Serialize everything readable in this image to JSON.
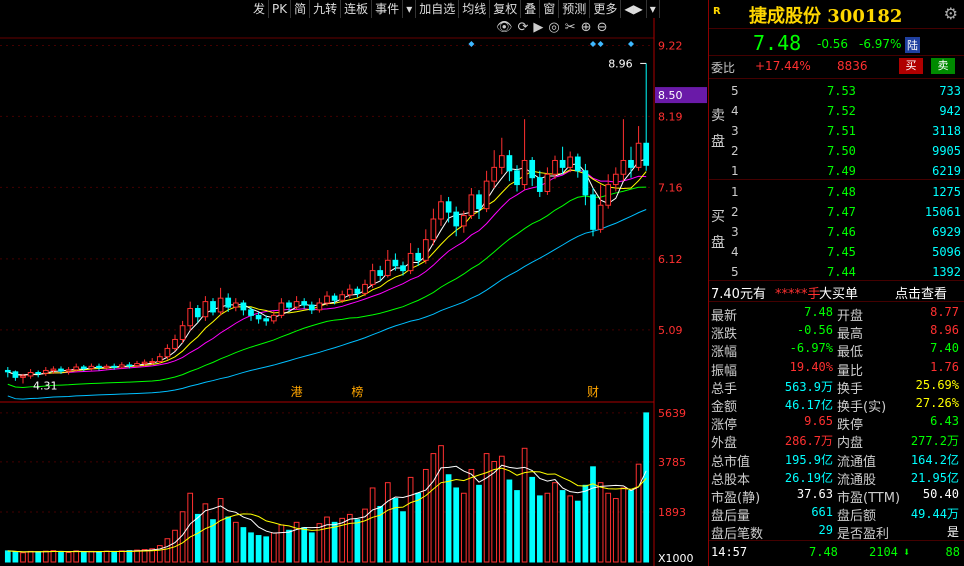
{
  "toolbar": {
    "items": [
      "发",
      "PK",
      "简",
      "九转",
      "连板",
      "事件",
      "▾",
      "加自选",
      "均线",
      "复权",
      "叠",
      "窗",
      "预测",
      "更多",
      "◀▶",
      "▾"
    ]
  },
  "chart_tools": [
    "👁",
    "⟳",
    "▶",
    "◎",
    "✂",
    "⊕",
    "⊖"
  ],
  "chart_data": {
    "type": "candlestick",
    "price_axis_ticks": [
      "9.22",
      "8.19",
      "7.16",
      "6.12",
      "5.09"
    ],
    "current_price_tag": "8.50",
    "high_label": "8.96",
    "low_label": "4.31",
    "event_markers": [
      "港",
      "榜",
      "财"
    ],
    "volume_axis_ticks": [
      "5639",
      "3785",
      "1893"
    ],
    "volume_unit": "X1000",
    "colors": {
      "up": "#ff3030",
      "down": "#00ffff",
      "ma5": "#ffffff",
      "ma10": "#ffff00",
      "ma20": "#ff00ff",
      "ma30": "#00ff00",
      "ma60": "#00bfff"
    },
    "candles": [
      [
        4.5,
        4.48,
        4.55,
        4.4
      ],
      [
        4.48,
        4.4,
        4.5,
        4.35
      ],
      [
        4.4,
        4.42,
        4.45,
        4.31
      ],
      [
        4.42,
        4.47,
        4.52,
        4.38
      ],
      [
        4.47,
        4.46,
        4.5,
        4.4
      ],
      [
        4.46,
        4.5,
        4.55,
        4.42
      ],
      [
        4.5,
        4.52,
        4.56,
        4.45
      ],
      [
        4.52,
        4.49,
        4.56,
        4.45
      ],
      [
        4.49,
        4.51,
        4.55,
        4.44
      ],
      [
        4.51,
        4.55,
        4.6,
        4.48
      ],
      [
        4.55,
        4.53,
        4.58,
        4.49
      ],
      [
        4.53,
        4.56,
        4.6,
        4.5
      ],
      [
        4.56,
        4.54,
        4.6,
        4.5
      ],
      [
        4.54,
        4.56,
        4.59,
        4.51
      ],
      [
        4.56,
        4.55,
        4.6,
        4.51
      ],
      [
        4.55,
        4.58,
        4.62,
        4.52
      ],
      [
        4.58,
        4.57,
        4.62,
        4.53
      ],
      [
        4.57,
        4.6,
        4.64,
        4.54
      ],
      [
        4.6,
        4.62,
        4.66,
        4.56
      ],
      [
        4.62,
        4.63,
        4.68,
        4.58
      ],
      [
        4.63,
        4.7,
        4.75,
        4.6
      ],
      [
        4.7,
        4.82,
        4.88,
        4.66
      ],
      [
        4.82,
        4.95,
        5.02,
        4.78
      ],
      [
        4.95,
        5.15,
        5.22,
        4.9
      ],
      [
        5.15,
        5.4,
        5.5,
        5.08
      ],
      [
        5.4,
        5.28,
        5.45,
        5.2
      ],
      [
        5.28,
        5.5,
        5.58,
        5.22
      ],
      [
        5.5,
        5.35,
        5.55,
        5.3
      ],
      [
        5.35,
        5.55,
        5.7,
        5.3
      ],
      [
        5.55,
        5.42,
        5.62,
        5.35
      ],
      [
        5.42,
        5.48,
        5.55,
        5.36
      ],
      [
        5.48,
        5.38,
        5.52,
        5.3
      ],
      [
        5.38,
        5.3,
        5.42,
        5.22
      ],
      [
        5.3,
        5.25,
        5.35,
        5.18
      ],
      [
        5.25,
        5.22,
        5.3,
        5.15
      ],
      [
        5.22,
        5.3,
        5.36,
        5.18
      ],
      [
        5.3,
        5.48,
        5.55,
        5.26
      ],
      [
        5.48,
        5.42,
        5.52,
        5.36
      ],
      [
        5.42,
        5.5,
        5.58,
        5.38
      ],
      [
        5.5,
        5.45,
        5.55,
        5.4
      ],
      [
        5.45,
        5.38,
        5.5,
        5.32
      ],
      [
        5.38,
        5.48,
        5.55,
        5.34
      ],
      [
        5.48,
        5.58,
        5.65,
        5.44
      ],
      [
        5.58,
        5.52,
        5.62,
        5.46
      ],
      [
        5.52,
        5.6,
        5.66,
        5.48
      ],
      [
        5.6,
        5.68,
        5.75,
        5.55
      ],
      [
        5.68,
        5.62,
        5.72,
        5.56
      ],
      [
        5.62,
        5.75,
        5.82,
        5.58
      ],
      [
        5.75,
        5.95,
        6.05,
        5.7
      ],
      [
        5.95,
        5.88,
        6.02,
        5.8
      ],
      [
        5.88,
        6.1,
        6.25,
        5.85
      ],
      [
        6.1,
        6.02,
        6.2,
        5.95
      ],
      [
        6.02,
        5.95,
        6.08,
        5.88
      ],
      [
        5.95,
        6.2,
        6.35,
        5.9
      ],
      [
        6.2,
        6.1,
        6.28,
        6.02
      ],
      [
        6.1,
        6.4,
        6.55,
        6.05
      ],
      [
        6.4,
        6.7,
        6.85,
        6.32
      ],
      [
        6.7,
        6.95,
        7.05,
        6.6
      ],
      [
        6.95,
        6.8,
        7.02,
        6.65
      ],
      [
        6.8,
        6.6,
        6.88,
        6.45
      ],
      [
        6.6,
        6.75,
        6.82,
        6.5
      ],
      [
        6.75,
        7.05,
        7.15,
        6.7
      ],
      [
        7.05,
        6.85,
        7.12,
        6.7
      ],
      [
        6.85,
        7.25,
        7.4,
        6.8
      ],
      [
        7.25,
        7.45,
        7.7,
        7.15
      ],
      [
        7.45,
        7.62,
        7.88,
        7.35
      ],
      [
        7.62,
        7.4,
        7.7,
        7.25
      ],
      [
        7.4,
        7.2,
        7.48,
        7.1
      ],
      [
        7.2,
        7.55,
        8.15,
        7.12
      ],
      [
        7.55,
        7.3,
        7.6,
        7.18
      ],
      [
        7.3,
        7.1,
        7.4,
        7.02
      ],
      [
        7.1,
        7.35,
        7.45,
        7.05
      ],
      [
        7.35,
        7.55,
        7.62,
        7.28
      ],
      [
        7.55,
        7.45,
        7.75,
        7.35
      ],
      [
        7.45,
        7.6,
        7.68,
        7.38
      ],
      [
        7.6,
        7.4,
        7.65,
        7.3
      ],
      [
        7.4,
        7.05,
        7.5,
        6.9
      ],
      [
        7.05,
        6.55,
        7.15,
        6.45
      ],
      [
        6.55,
        6.9,
        7.2,
        6.5
      ],
      [
        6.9,
        7.2,
        7.35,
        6.85
      ],
      [
        7.2,
        7.35,
        7.45,
        7.1
      ],
      [
        7.35,
        7.55,
        8.15,
        7.25
      ],
      [
        7.55,
        7.45,
        7.75,
        7.3
      ],
      [
        7.45,
        7.8,
        8.05,
        7.4
      ],
      [
        7.8,
        7.48,
        8.96,
        7.4
      ]
    ],
    "volumes": [
      420,
      380,
      350,
      400,
      390,
      410,
      430,
      380,
      360,
      420,
      390,
      400,
      380,
      410,
      400,
      420,
      430,
      450,
      470,
      500,
      620,
      880,
      1200,
      1900,
      2600,
      1800,
      2200,
      1600,
      2400,
      1700,
      1500,
      1300,
      1100,
      1000,
      950,
      1100,
      1400,
      1200,
      1500,
      1300,
      1100,
      1450,
      1700,
      1500,
      1650,
      1800,
      1600,
      2000,
      2800,
      2100,
      3000,
      2400,
      1900,
      3200,
      2600,
      3500,
      4100,
      4400,
      3300,
      2800,
      2600,
      3500,
      2900,
      4100,
      3800,
      4000,
      3100,
      2700,
      4300,
      3200,
      2500,
      2600,
      3000,
      2700,
      2500,
      2300,
      2900,
      3600,
      3000,
      2600,
      2400,
      2800,
      2700,
      3700,
      5639
    ]
  },
  "quote": {
    "flag": "R",
    "title": "捷成股份 300182",
    "price": "7.48",
    "change": "-0.56",
    "pct": "-6.97%",
    "market": "陆"
  },
  "weibi": {
    "label": "委比",
    "ratio": "+17.44%",
    "diff": "8836",
    "buy_btn": "买",
    "sell_btn": "卖"
  },
  "sell_side_label": "卖盘",
  "buy_side_label": "买盘",
  "asks": [
    {
      "n": "5",
      "price": "7.53",
      "vol": "733"
    },
    {
      "n": "4",
      "price": "7.52",
      "vol": "942"
    },
    {
      "n": "3",
      "price": "7.51",
      "vol": "3118"
    },
    {
      "n": "2",
      "price": "7.50",
      "vol": "9905"
    },
    {
      "n": "1",
      "price": "7.49",
      "vol": "6219"
    }
  ],
  "bids": [
    {
      "n": "1",
      "price": "7.48",
      "vol": "1275"
    },
    {
      "n": "2",
      "price": "7.47",
      "vol": "15061"
    },
    {
      "n": "3",
      "price": "7.46",
      "vol": "6929"
    },
    {
      "n": "4",
      "price": "7.45",
      "vol": "5096"
    },
    {
      "n": "5",
      "price": "7.44",
      "vol": "1392"
    }
  ],
  "big_order": {
    "price": "7.40元有",
    "masked": "*****手",
    "label": "大买单",
    "action": "点击查看"
  },
  "stats": [
    {
      "k": "最新",
      "v": "7.48",
      "c": "#00ff00"
    },
    {
      "k": "开盘",
      "v": "8.77",
      "c": "#ff3030"
    },
    {
      "k": "涨跌",
      "v": "-0.56",
      "c": "#00ff00"
    },
    {
      "k": "最高",
      "v": "8.96",
      "c": "#ff3030"
    },
    {
      "k": "涨幅",
      "v": "-6.97%",
      "c": "#00ff00"
    },
    {
      "k": "最低",
      "v": "7.40",
      "c": "#00ff00"
    },
    {
      "k": "振幅",
      "v": "19.40%",
      "c": "#ff3030"
    },
    {
      "k": "量比",
      "v": "1.76",
      "c": "#ff3030"
    },
    {
      "k": "总手",
      "v": "563.9万",
      "c": "#00ffff"
    },
    {
      "k": "换手",
      "v": "25.69%",
      "c": "#ffff00"
    },
    {
      "k": "金额",
      "v": "46.17亿",
      "c": "#00ffff"
    },
    {
      "k": "换手(实)",
      "v": "27.26%",
      "c": "#ffff00"
    },
    {
      "k": "涨停",
      "v": "9.65",
      "c": "#ff3030"
    },
    {
      "k": "跌停",
      "v": "6.43",
      "c": "#00ff00"
    },
    {
      "k": "外盘",
      "v": "286.7万",
      "c": "#ff3030"
    },
    {
      "k": "内盘",
      "v": "277.2万",
      "c": "#00ff00"
    },
    {
      "k": "总市值",
      "v": "195.9亿",
      "c": "#00ffff"
    },
    {
      "k": "流通值",
      "v": "164.2亿",
      "c": "#00ffff"
    },
    {
      "k": "总股本",
      "v": "26.19亿",
      "c": "#00ffff"
    },
    {
      "k": "流通股",
      "v": "21.95亿",
      "c": "#00ffff"
    },
    {
      "k": "市盈(静)",
      "v": "37.63",
      "c": "#ffffff"
    },
    {
      "k": "市盈(TTM)",
      "v": "50.40",
      "c": "#ffffff"
    },
    {
      "k": "盘后量",
      "v": "661",
      "c": "#00ffff"
    },
    {
      "k": "盘后额",
      "v": "49.44万",
      "c": "#00ffff"
    },
    {
      "k": "盘后笔数",
      "v": "29",
      "c": "#00ffff"
    },
    {
      "k": "是否盈利",
      "v": "是",
      "c": "#ffffff"
    }
  ],
  "last_tick": {
    "time": "14:57",
    "price": "7.48",
    "vol": "2104",
    "dir": "⬇",
    "n": "88"
  }
}
